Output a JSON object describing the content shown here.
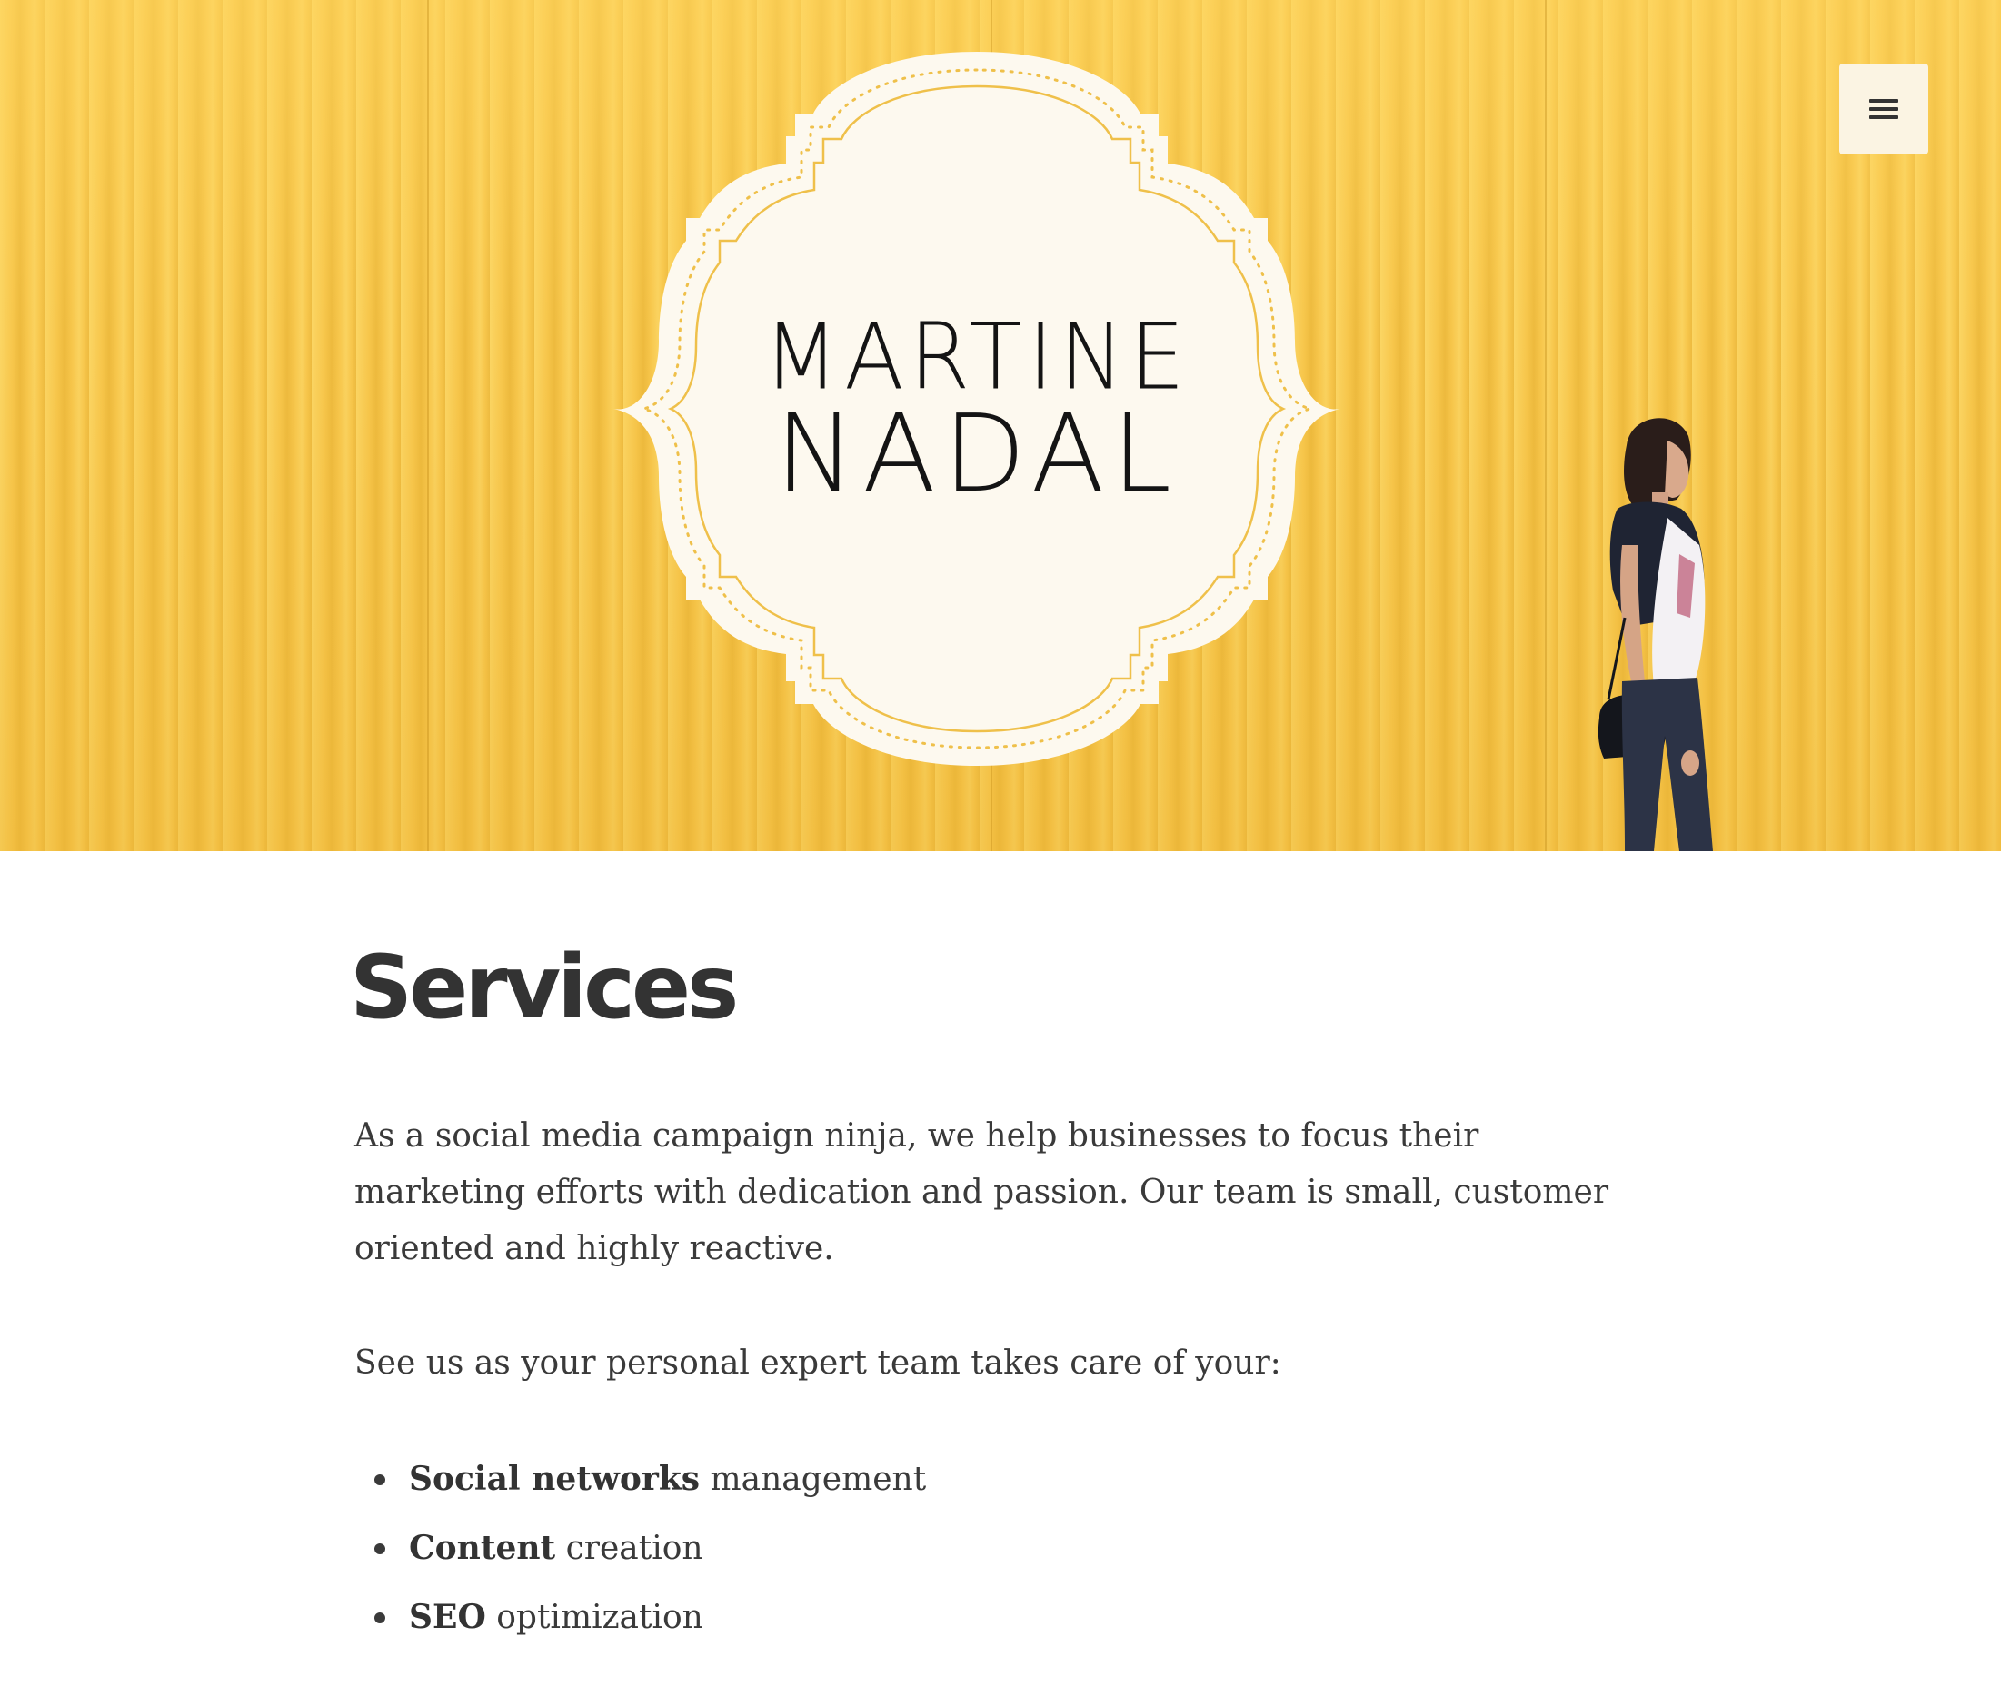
{
  "header": {
    "logo_line_1": "MARTINE",
    "logo_line_2": "NADAL",
    "menu_icon": "hamburger-menu-icon"
  },
  "colors": {
    "hero_yellow": "#f7c64b",
    "logo_frame": "#fdf9ef",
    "text_dark": "#333333"
  },
  "main": {
    "title": "Services",
    "intro": "As a social media campaign ninja, we help businesses to focus their marketing efforts with dedication and passion. Our team is small, customer oriented and highly reactive.",
    "lead_in": "See us as your personal expert team takes care of your:",
    "services": [
      {
        "bold": "Social networks",
        "rest": " management"
      },
      {
        "bold": "Content",
        "rest": " creation"
      },
      {
        "bold": "SEO",
        "rest": " optimization"
      }
    ]
  }
}
